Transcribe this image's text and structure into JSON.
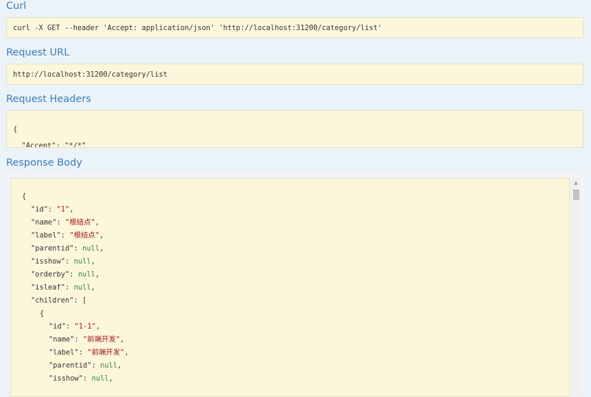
{
  "curl": {
    "title": "Curl",
    "command": "curl -X GET --header 'Accept: application/json' 'http://localhost:31200/category/list'"
  },
  "request_url": {
    "title": "Request URL",
    "value": "http://localhost:31200/category/list"
  },
  "request_headers": {
    "title": "Request Headers",
    "lines": [
      "{",
      "  \"Accept\": \"*/*\"",
      "}"
    ]
  },
  "response_body": {
    "title": "Response Body",
    "lines": [
      {
        "indent": 0,
        "tokens": [
          {
            "t": "p",
            "v": "{"
          }
        ]
      },
      {
        "indent": 1,
        "tokens": [
          {
            "t": "p",
            "v": "\"id\": "
          },
          {
            "t": "s",
            "v": "\"1\""
          },
          {
            "t": "p",
            "v": ","
          }
        ]
      },
      {
        "indent": 1,
        "tokens": [
          {
            "t": "p",
            "v": "\"name\": "
          },
          {
            "t": "s",
            "v": "\"根结点\""
          },
          {
            "t": "p",
            "v": ","
          }
        ]
      },
      {
        "indent": 1,
        "tokens": [
          {
            "t": "p",
            "v": "\"label\": "
          },
          {
            "t": "s",
            "v": "\"根结点\""
          },
          {
            "t": "p",
            "v": ","
          }
        ]
      },
      {
        "indent": 1,
        "tokens": [
          {
            "t": "p",
            "v": "\"parentid\": "
          },
          {
            "t": "n",
            "v": "null"
          },
          {
            "t": "p",
            "v": ","
          }
        ]
      },
      {
        "indent": 1,
        "tokens": [
          {
            "t": "p",
            "v": "\"isshow\": "
          },
          {
            "t": "n",
            "v": "null"
          },
          {
            "t": "p",
            "v": ","
          }
        ]
      },
      {
        "indent": 1,
        "tokens": [
          {
            "t": "p",
            "v": "\"orderby\": "
          },
          {
            "t": "n",
            "v": "null"
          },
          {
            "t": "p",
            "v": ","
          }
        ]
      },
      {
        "indent": 1,
        "tokens": [
          {
            "t": "p",
            "v": "\"isleaf\": "
          },
          {
            "t": "n",
            "v": "null"
          },
          {
            "t": "p",
            "v": ","
          }
        ]
      },
      {
        "indent": 1,
        "tokens": [
          {
            "t": "p",
            "v": "\"children\": ["
          }
        ]
      },
      {
        "indent": 2,
        "tokens": [
          {
            "t": "p",
            "v": "{"
          }
        ]
      },
      {
        "indent": 3,
        "tokens": [
          {
            "t": "p",
            "v": "\"id\": "
          },
          {
            "t": "s",
            "v": "\"1-1\""
          },
          {
            "t": "p",
            "v": ","
          }
        ]
      },
      {
        "indent": 3,
        "tokens": [
          {
            "t": "p",
            "v": "\"name\": "
          },
          {
            "t": "s",
            "v": "\"前端开发\""
          },
          {
            "t": "p",
            "v": ","
          }
        ]
      },
      {
        "indent": 3,
        "tokens": [
          {
            "t": "p",
            "v": "\"label\": "
          },
          {
            "t": "s",
            "v": "\"前端开发\""
          },
          {
            "t": "p",
            "v": ","
          }
        ]
      },
      {
        "indent": 3,
        "tokens": [
          {
            "t": "p",
            "v": "\"parentid\": "
          },
          {
            "t": "n",
            "v": "null"
          },
          {
            "t": "p",
            "v": ","
          }
        ]
      },
      {
        "indent": 3,
        "tokens": [
          {
            "t": "p",
            "v": "\"isshow\": "
          },
          {
            "t": "n",
            "v": "null"
          },
          {
            "t": "p",
            "v": ","
          }
        ]
      }
    ]
  },
  "scrollbar": {
    "up_arrow": "▲"
  }
}
